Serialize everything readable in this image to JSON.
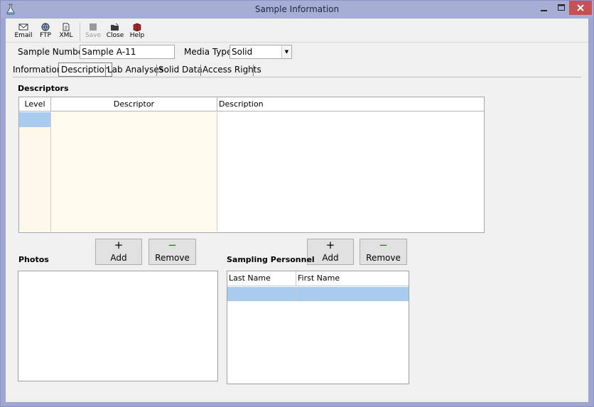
{
  "window": {
    "title": "Sample Information"
  },
  "toolbar": {
    "items": [
      {
        "label": "Email",
        "icon": "envelope-icon",
        "enabled": true
      },
      {
        "label": "FTP",
        "icon": "globe-icon",
        "enabled": true
      },
      {
        "label": "XML",
        "icon": "document-icon",
        "enabled": true
      },
      {
        "label": "Save",
        "icon": "save-icon",
        "enabled": false
      },
      {
        "label": "Close",
        "icon": "close-folder-icon",
        "enabled": true
      },
      {
        "label": "Help",
        "icon": "help-book-icon",
        "enabled": true
      }
    ]
  },
  "header": {
    "sample_number_label": "Sample Number:",
    "sample_number_value": "Sample A-11",
    "media_type_label": "Media Type:",
    "media_type_value": "Solid"
  },
  "tabs": [
    {
      "label": "Information",
      "selected": false
    },
    {
      "label": "Description",
      "selected": true
    },
    {
      "label": "Lab Analyses",
      "selected": false
    },
    {
      "label": "Solid Data",
      "selected": false
    },
    {
      "label": "Access Rights",
      "selected": false
    }
  ],
  "descriptors": {
    "title": "Descriptors",
    "columns": [
      "Level",
      "Descriptor",
      "Description"
    ],
    "rows": [
      [
        "",
        "",
        ""
      ],
      [
        "",
        "",
        ""
      ],
      [
        "",
        "",
        ""
      ],
      [
        "",
        "",
        ""
      ],
      [
        "",
        "",
        ""
      ],
      [
        "",
        "",
        ""
      ],
      [
        "",
        "",
        ""
      ],
      [
        "",
        "",
        ""
      ]
    ]
  },
  "photos": {
    "title": "Photos",
    "add_symbol": "+",
    "add_label": "Add",
    "remove_symbol": "−",
    "remove_label": "Remove"
  },
  "personnel": {
    "title": "Sampling Personnel",
    "add_symbol": "+",
    "add_label": "Add",
    "remove_symbol": "−",
    "remove_label": "Remove",
    "columns": [
      "Last Name",
      "First Name"
    ],
    "rows": [
      [
        "",
        ""
      ]
    ]
  },
  "colors": {
    "title_bar": "#a6aed6",
    "selection": "#a8cbee",
    "descriptor_column": "#fffaeb",
    "level_column": "#fdf8ea",
    "close_button": "#c75050"
  }
}
